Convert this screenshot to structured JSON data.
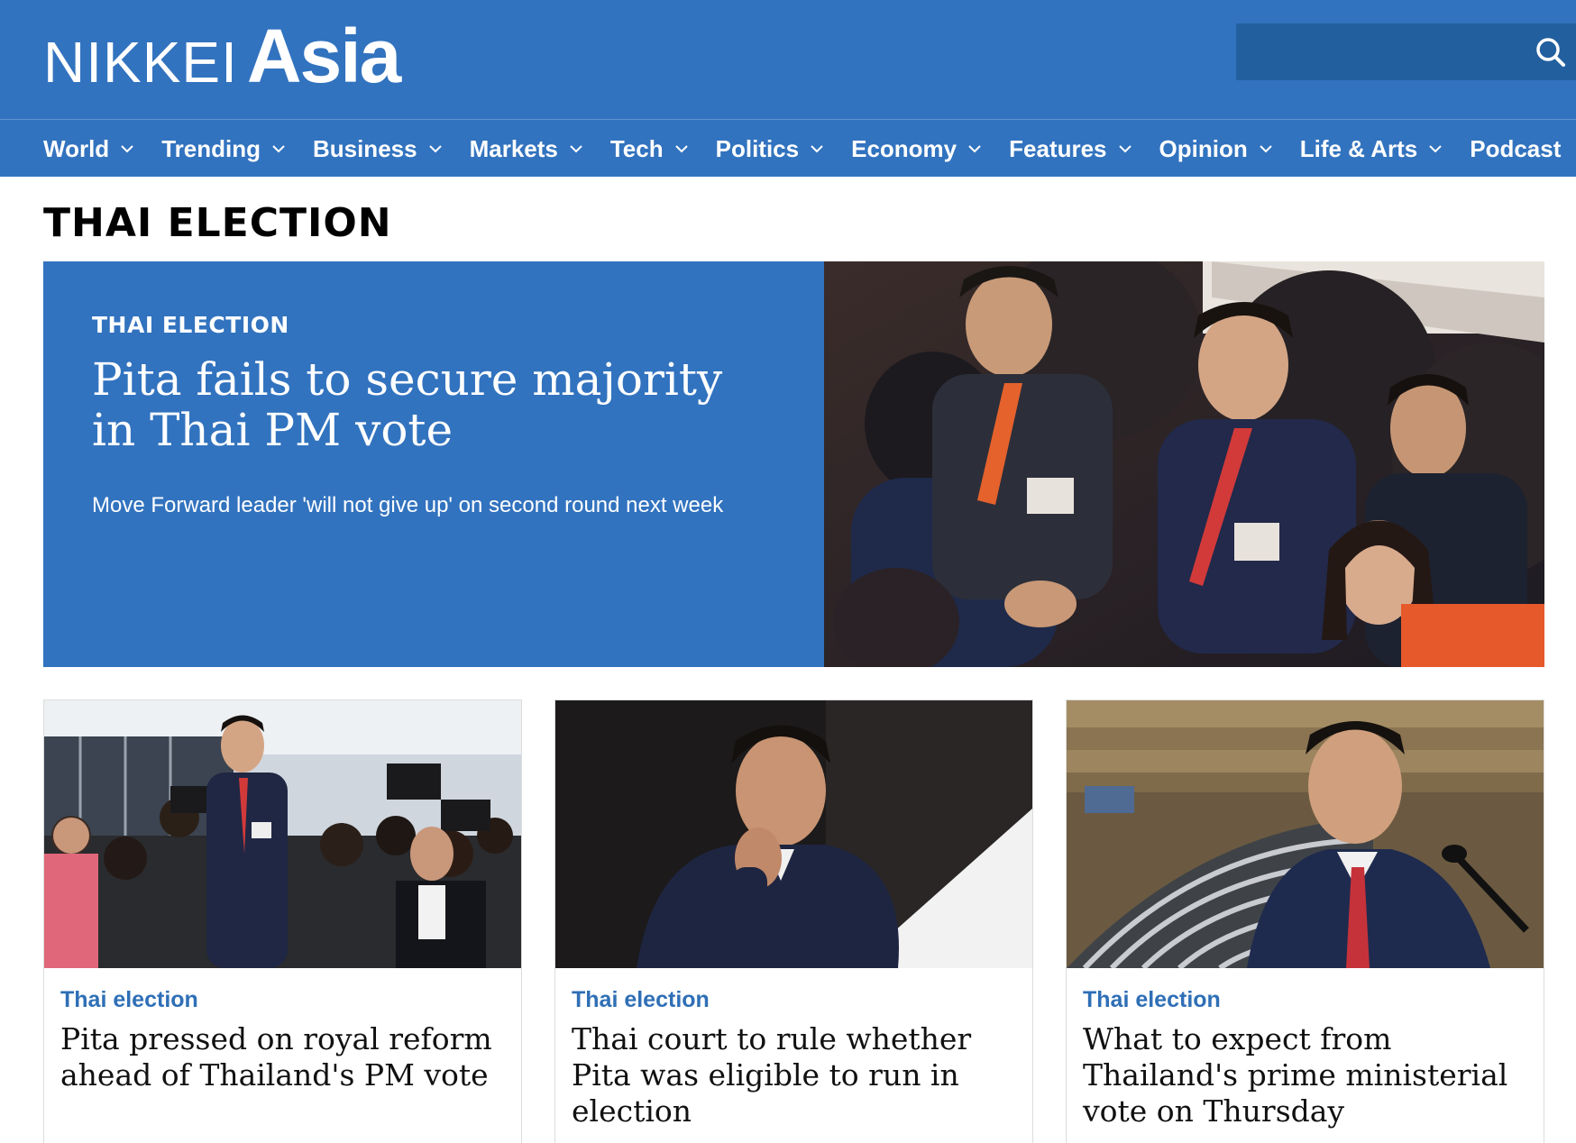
{
  "brand": {
    "name_part1": "NIKKEI",
    "name_part2": "Asia"
  },
  "search": {
    "placeholder": ""
  },
  "nav": {
    "items": [
      {
        "label": "World",
        "has_dropdown": true
      },
      {
        "label": "Trending",
        "has_dropdown": true
      },
      {
        "label": "Business",
        "has_dropdown": true
      },
      {
        "label": "Markets",
        "has_dropdown": true
      },
      {
        "label": "Tech",
        "has_dropdown": true
      },
      {
        "label": "Politics",
        "has_dropdown": true
      },
      {
        "label": "Economy",
        "has_dropdown": true
      },
      {
        "label": "Features",
        "has_dropdown": true
      },
      {
        "label": "Opinion",
        "has_dropdown": true
      },
      {
        "label": "Life & Arts",
        "has_dropdown": true
      },
      {
        "label": "Podcast",
        "has_dropdown": false
      }
    ]
  },
  "section": {
    "title": "THAI ELECTION"
  },
  "hero": {
    "kicker": "THAI ELECTION",
    "headline": "Pita fails to secure majority in Thai PM vote",
    "subhead": "Move Forward leader 'will not give up' on second round next week"
  },
  "cards": [
    {
      "tag": "Thai election",
      "title": "Pita pressed on royal reform ahead of Thailand's PM vote"
    },
    {
      "tag": "Thai election",
      "title": "Thai court to rule whether Pita was eligible to run in election"
    },
    {
      "tag": "Thai election",
      "title": "What to expect from Thailand's prime ministerial vote on Thursday"
    }
  ],
  "colors": {
    "brand_blue": "#3273bf",
    "search_bg": "#225f9f",
    "tag_blue": "#2f6fb6"
  },
  "icons": {
    "search": "search-icon",
    "dropdown": "chevron-down-icon"
  }
}
